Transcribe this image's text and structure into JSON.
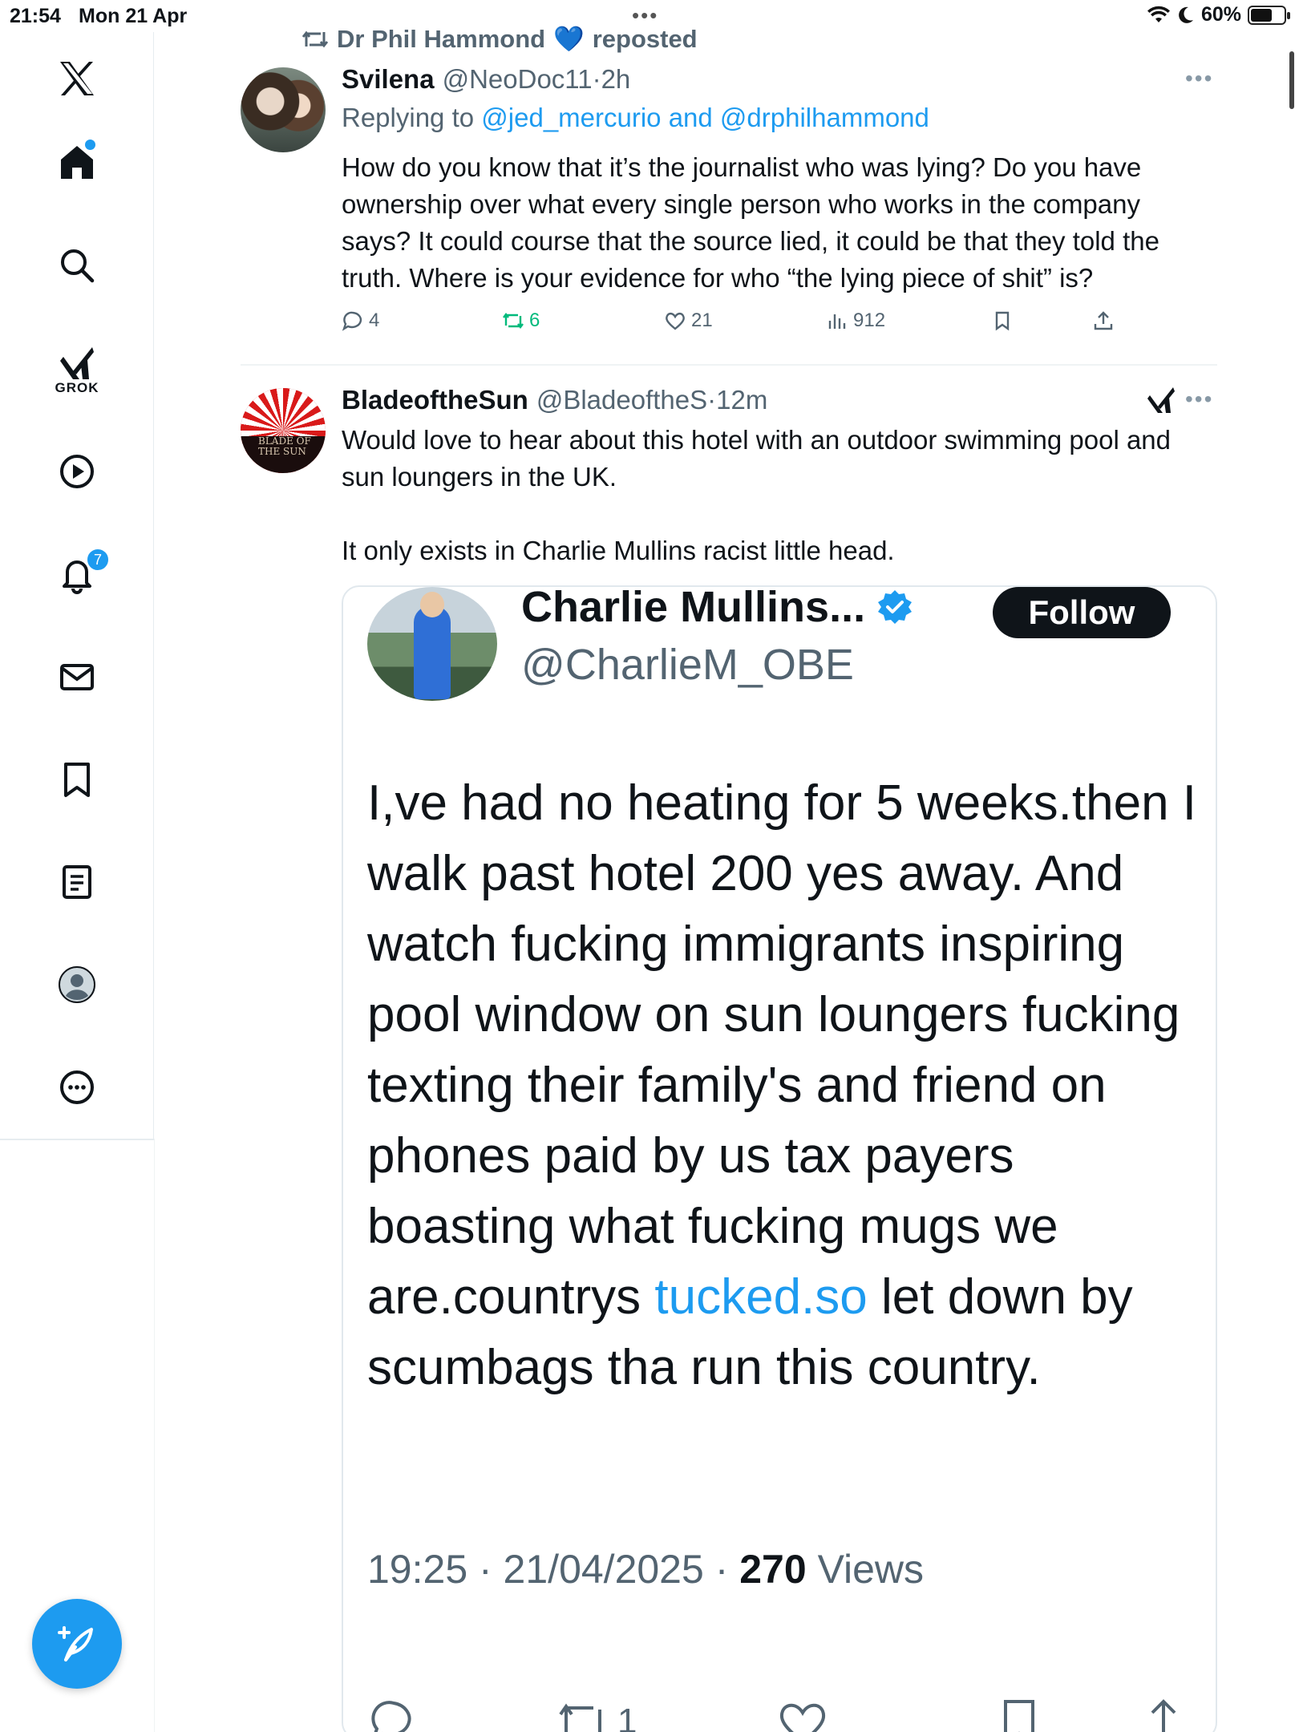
{
  "status_bar": {
    "time": "21:54",
    "date": "Mon 21 Apr",
    "battery": "60%"
  },
  "sidebar": {
    "items": [
      {
        "name": "home",
        "icon": "home-icon"
      },
      {
        "name": "explore",
        "icon": "search-icon"
      },
      {
        "name": "grok",
        "icon": "grok-icon",
        "label": "GROK"
      },
      {
        "name": "video",
        "icon": "play-icon"
      },
      {
        "name": "notifications",
        "icon": "bell-icon",
        "badge": "7"
      },
      {
        "name": "messages",
        "icon": "envelope-icon"
      },
      {
        "name": "bookmarks",
        "icon": "bookmark-icon"
      },
      {
        "name": "lists",
        "icon": "list-icon"
      },
      {
        "name": "profile",
        "icon": "profile-icon"
      },
      {
        "name": "more",
        "icon": "more-icon"
      }
    ],
    "accent": "#1d9bf0"
  },
  "tweet1": {
    "repost_by": "Dr Phil Hammond",
    "repost_emoji": "💙",
    "repost_label": "reposted",
    "name": "Svilena",
    "handle": "@NeoDoc11",
    "sep": "·",
    "time": "2h",
    "replying_prefix": "Replying to",
    "replying_links": "@jed_mercurio and @drphilhammond",
    "text": "How do you know that it’s the journalist who was lying? Do you have\nownership over what every single person who works in the company\nsays? It could course that the source lied, it could be that they told the\ntruth. Where is your evidence for who “the lying piece of shit” is?",
    "replies": "4",
    "reposts": "6",
    "likes": "21",
    "views": "912"
  },
  "tweet2": {
    "name": "BladeoftheSun",
    "handle": "@BladeoftheS",
    "sep": "·",
    "time": "12m",
    "avatar_text": "BLADE OF THE SUN",
    "text": "Would love to hear about this hotel with an outdoor swimming pool and\nsun loungers in the UK.\n\nIt only exists in Charlie Mullins racist little head."
  },
  "embed": {
    "name": "Charlie Mullins...",
    "handle": "@CharlieM_OBE",
    "follow_label": "Follow",
    "text_before_link": "I,ve had no heating for 5 weeks.then I walk past hotel 200 yes away. And watch fucking immigrants inspiring pool window on sun loungers  fucking texting their family's and friend on phones paid by us tax payers boasting what fucking mugs we are.countrys ",
    "text_link": "tucked.so",
    "text_after_link": " let down by scumbags tha run this country.",
    "meta_time": "19:25 · 21/04/2025 · ",
    "meta_views_count": "270",
    "meta_views_label": " Views",
    "reposts": "1"
  }
}
